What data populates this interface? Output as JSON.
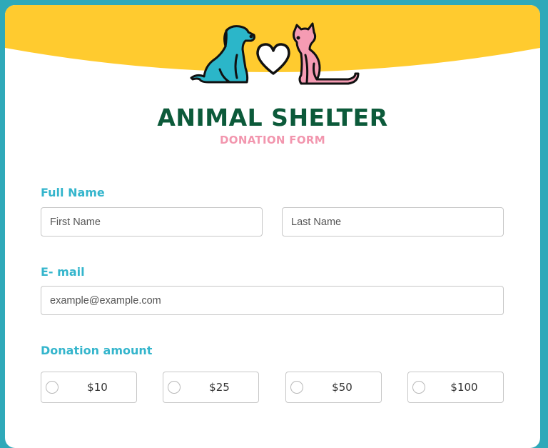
{
  "header": {
    "title": "ANIMAL SHELTER",
    "subtitle": "DONATION FORM",
    "logo_icon": "dog-heart-cat-icon"
  },
  "colors": {
    "page_background": "#2fa9b9",
    "banner": "#ffcb2f",
    "title": "#0c5a3a",
    "subtitle": "#f296ae",
    "label": "#34b5cc",
    "dog": "#2bb6c9",
    "cat": "#f59bb3"
  },
  "form": {
    "full_name": {
      "label": "Full Name",
      "first_placeholder": "First Name",
      "last_placeholder": "Last Name"
    },
    "email": {
      "label": "E- mail",
      "placeholder": "example@example.com"
    },
    "donation": {
      "label": "Donation amount",
      "options": [
        {
          "label": "$10",
          "selected": false
        },
        {
          "label": "$25",
          "selected": false
        },
        {
          "label": "$50",
          "selected": false
        },
        {
          "label": "$100",
          "selected": false
        }
      ]
    }
  }
}
